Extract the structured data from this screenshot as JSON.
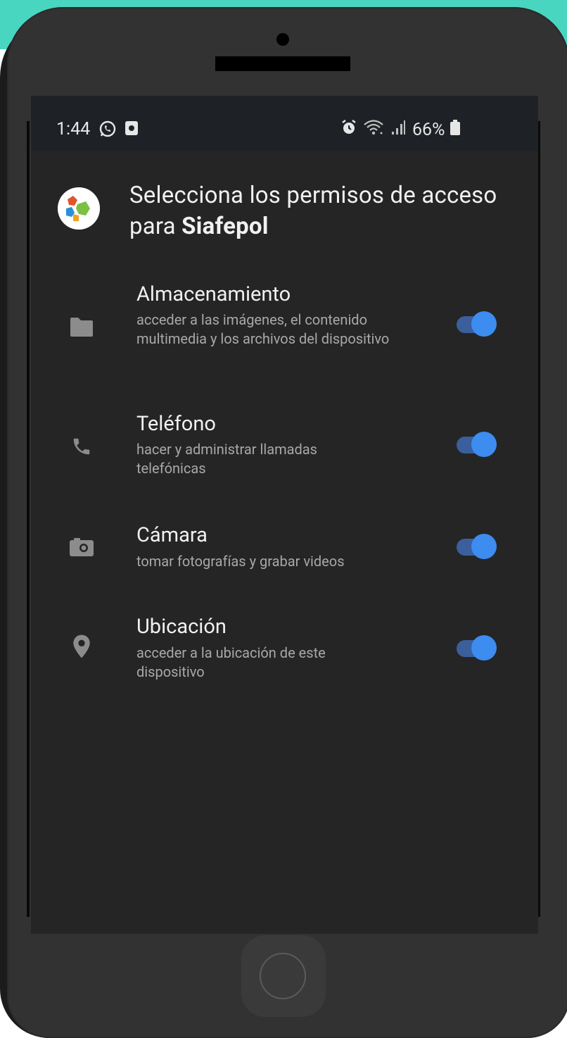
{
  "status_bar": {
    "time": "1:44",
    "battery": "66%",
    "left_icons": [
      "whatsapp-icon",
      "media-icon"
    ],
    "right_icons": [
      "alarm-icon",
      "wifi-icon",
      "signal-icon",
      "battery-icon"
    ]
  },
  "header": {
    "title_prefix": "Selecciona los permisos de acceso para ",
    "app_name": "Siafepol"
  },
  "permissions": [
    {
      "icon": "folder-icon",
      "title": "Almacenamiento",
      "description": "acceder a las imágenes, el contenido multimedia y los archivos del dispositivo",
      "enabled": true
    },
    {
      "icon": "phone-icon",
      "title": "Teléfono",
      "description": "hacer y administrar llamadas telefónicas",
      "enabled": true
    },
    {
      "icon": "camera-icon",
      "title": "Cámara",
      "description": "tomar fotografías y grabar videos",
      "enabled": true
    },
    {
      "icon": "location-icon",
      "title": "Ubicación",
      "description": "acceder a la ubicación de este dispositivo",
      "enabled": true
    }
  ],
  "colors": {
    "accent": "#3d8cf0",
    "background": "#252525",
    "frame": "#323232",
    "teal": "#49d6c1"
  }
}
